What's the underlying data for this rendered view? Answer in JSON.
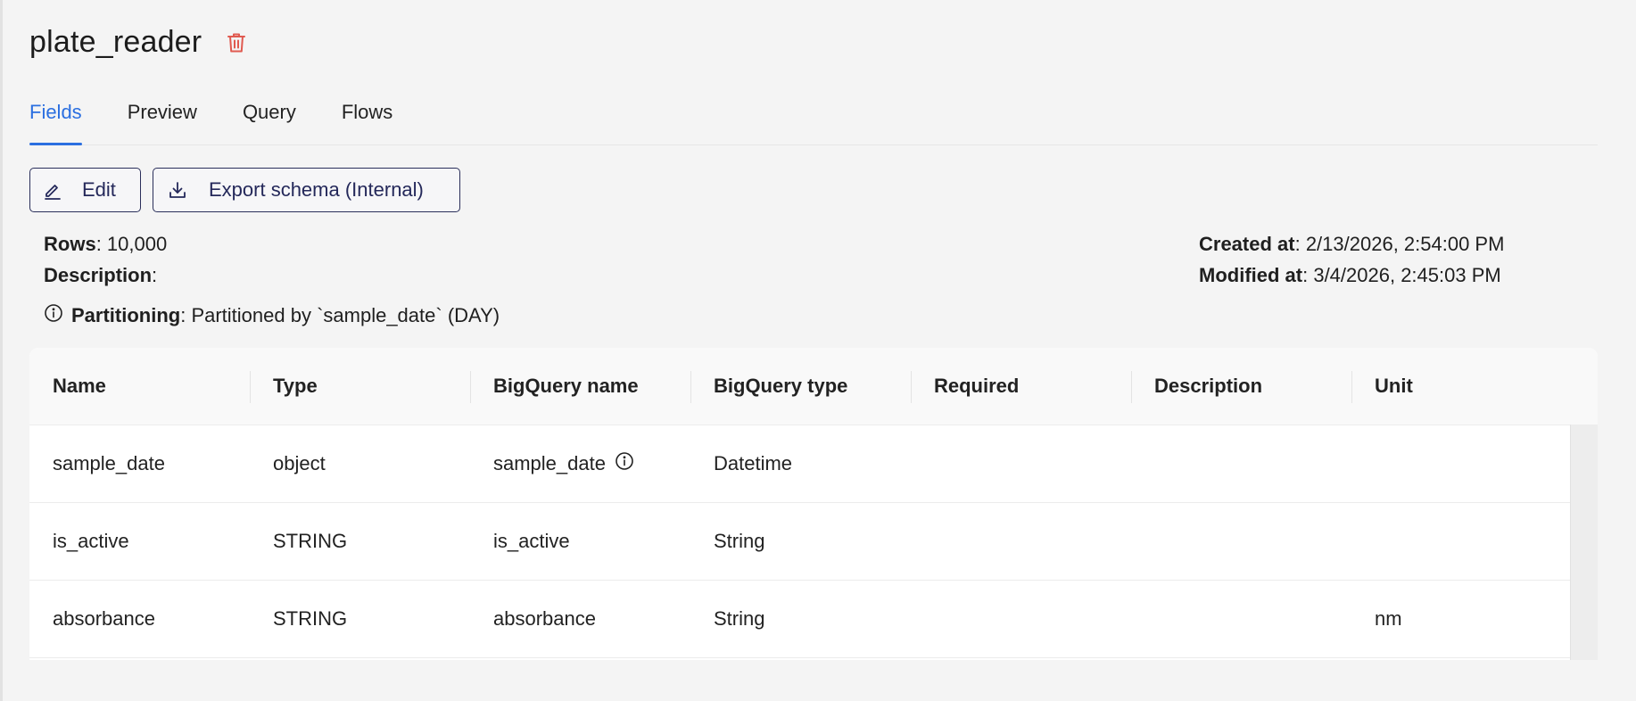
{
  "header": {
    "title": "plate_reader"
  },
  "tabs": [
    {
      "label": "Fields",
      "active": true
    },
    {
      "label": "Preview",
      "active": false
    },
    {
      "label": "Query",
      "active": false
    },
    {
      "label": "Flows",
      "active": false
    }
  ],
  "toolbar": {
    "edit_label": "Edit",
    "export_label": "Export schema (Internal)"
  },
  "meta": {
    "rows_label": "Rows",
    "rows_value": ": 10,000",
    "description_label": "Description",
    "description_value": ":",
    "created_label": "Created at",
    "created_value": ": 2/13/2026, 2:54:00 PM",
    "modified_label": "Modified at",
    "modified_value": ": 3/4/2026, 2:45:03 PM"
  },
  "partitioning": {
    "label": "Partitioning",
    "value": ": Partitioned by `sample_date` (DAY)"
  },
  "table": {
    "columns": [
      "Name",
      "Type",
      "BigQuery name",
      "BigQuery type",
      "Required",
      "Description",
      "Unit"
    ],
    "rows": [
      [
        "sample_date",
        "object",
        "sample_date",
        "Datetime",
        "",
        "",
        ""
      ],
      [
        "is_active",
        "STRING",
        "is_active",
        "String",
        "",
        "",
        ""
      ],
      [
        "absorbance",
        "STRING",
        "absorbance",
        "String",
        "",
        "",
        "nm"
      ]
    ]
  },
  "colors": {
    "accent": "#2b6fe0",
    "danger": "#e05a50",
    "button_border": "#2a2f5a"
  },
  "icons": {
    "delete": "trash-icon",
    "edit": "pencil-icon",
    "export": "download-icon",
    "info": "info-icon"
  }
}
